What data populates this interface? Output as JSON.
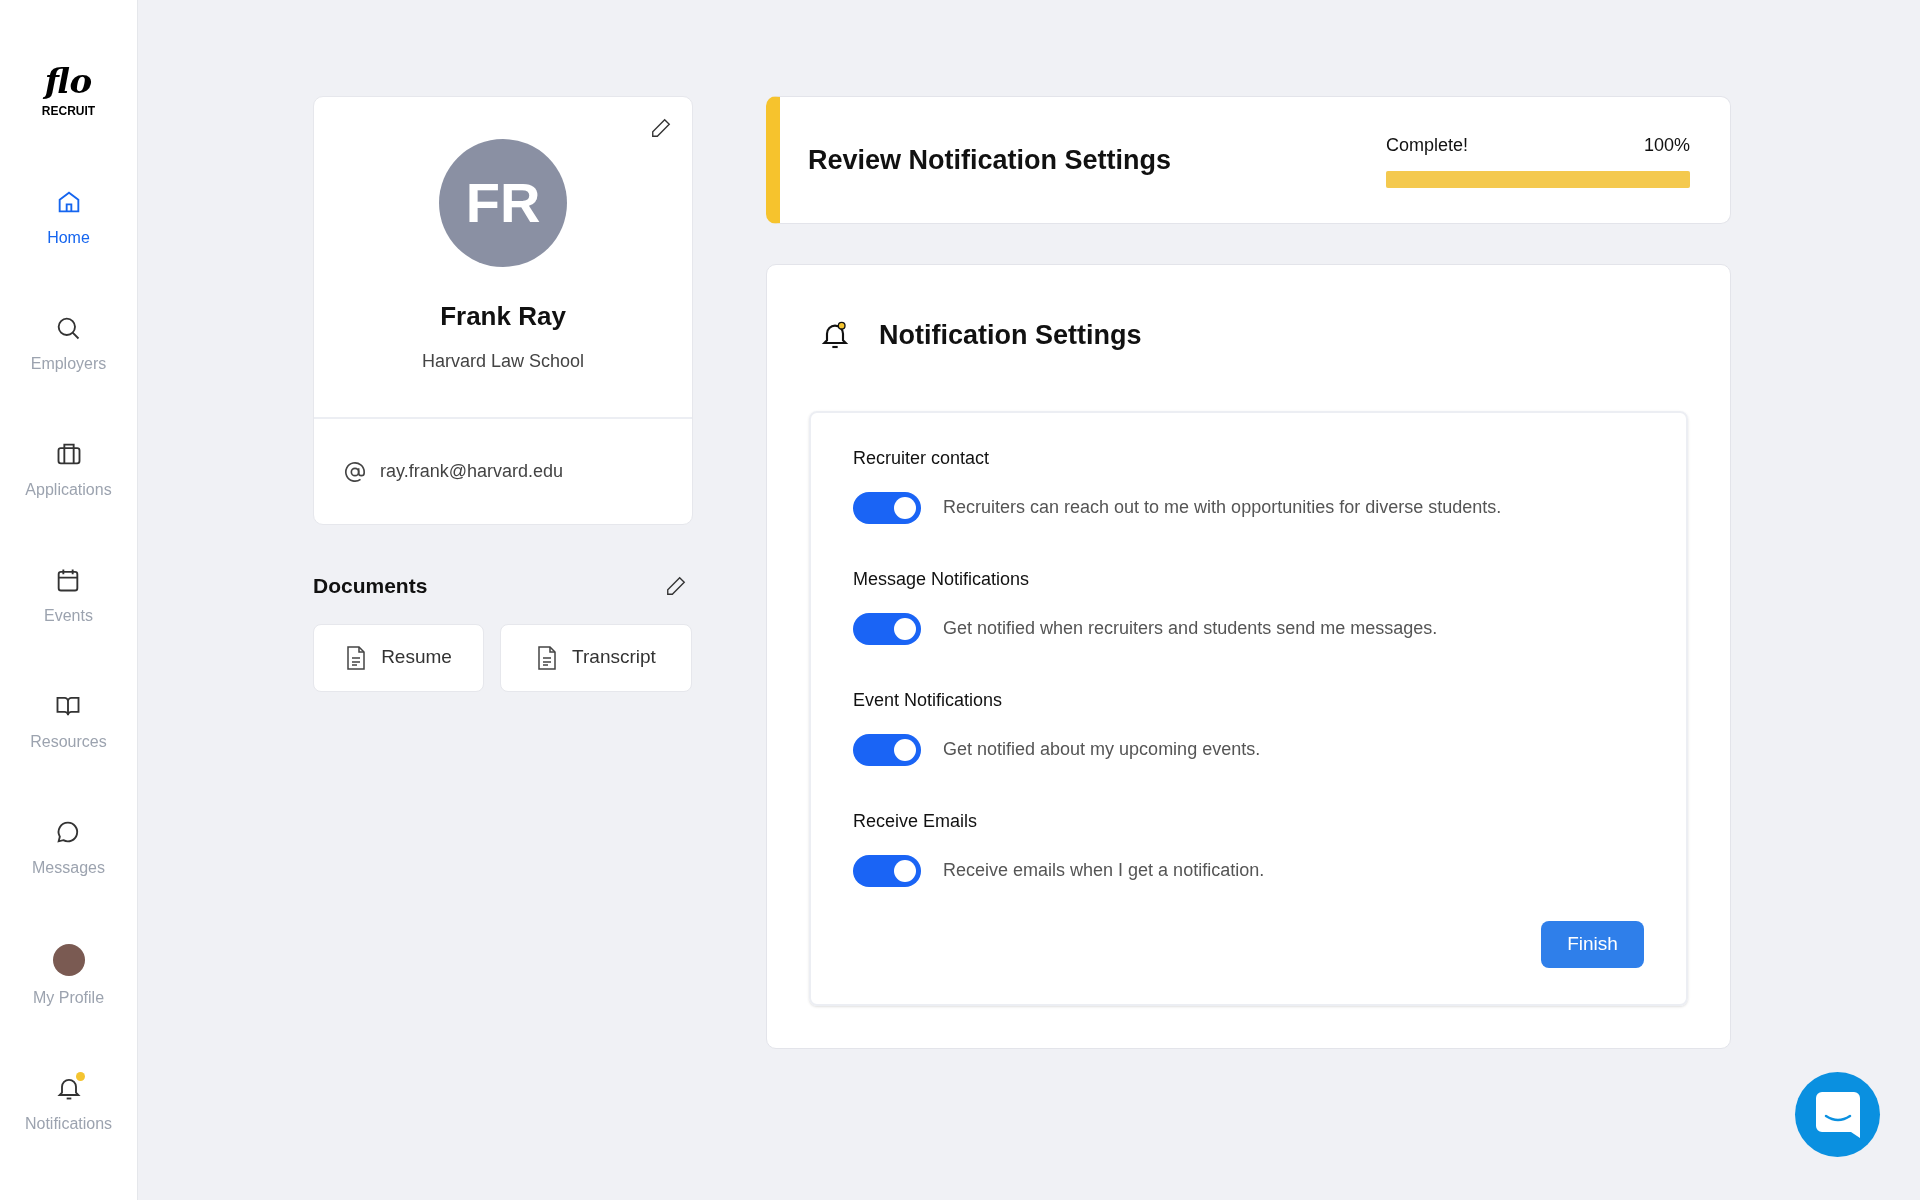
{
  "logo": {
    "wordmark": "flo",
    "subtitle": "RECRUIT"
  },
  "sidebar": {
    "items": [
      {
        "label": "Home",
        "kind": "home",
        "selected": true
      },
      {
        "label": "Employers",
        "kind": "search",
        "selected": false
      },
      {
        "label": "Applications",
        "kind": "briefcase",
        "selected": false
      },
      {
        "label": "Events",
        "kind": "calendar",
        "selected": false
      },
      {
        "label": "Resources",
        "kind": "book",
        "selected": false
      },
      {
        "label": "Messages",
        "kind": "chat",
        "selected": false
      },
      {
        "label": "My Profile",
        "kind": "avatar",
        "selected": false
      },
      {
        "label": "Notifications",
        "kind": "bell",
        "selected": false,
        "badge": true
      }
    ]
  },
  "profile": {
    "initials": "FR",
    "name": "Frank Ray",
    "school": "Harvard Law School",
    "email": "ray.frank@harvard.edu"
  },
  "documents": {
    "title": "Documents",
    "items": [
      "Resume",
      "Transcript"
    ]
  },
  "progress_card": {
    "title": "Review Notification Settings",
    "status": "Complete!",
    "percent": "100%",
    "level": 1.0
  },
  "settings": {
    "title": "Notification Settings",
    "options": [
      {
        "label": "Recruiter contact",
        "description": "Recruiters can reach out to me with opportunities for diverse students.",
        "on": true
      },
      {
        "label": "Message Notifications",
        "description": "Get notified when recruiters and students send me messages.",
        "on": true
      },
      {
        "label": "Event Notifications",
        "description": "Get notified about my upcoming events.",
        "on": true
      },
      {
        "label": "Receive Emails",
        "description": "Receive emails when I get a notification.",
        "on": true
      }
    ],
    "button": "Finish"
  }
}
